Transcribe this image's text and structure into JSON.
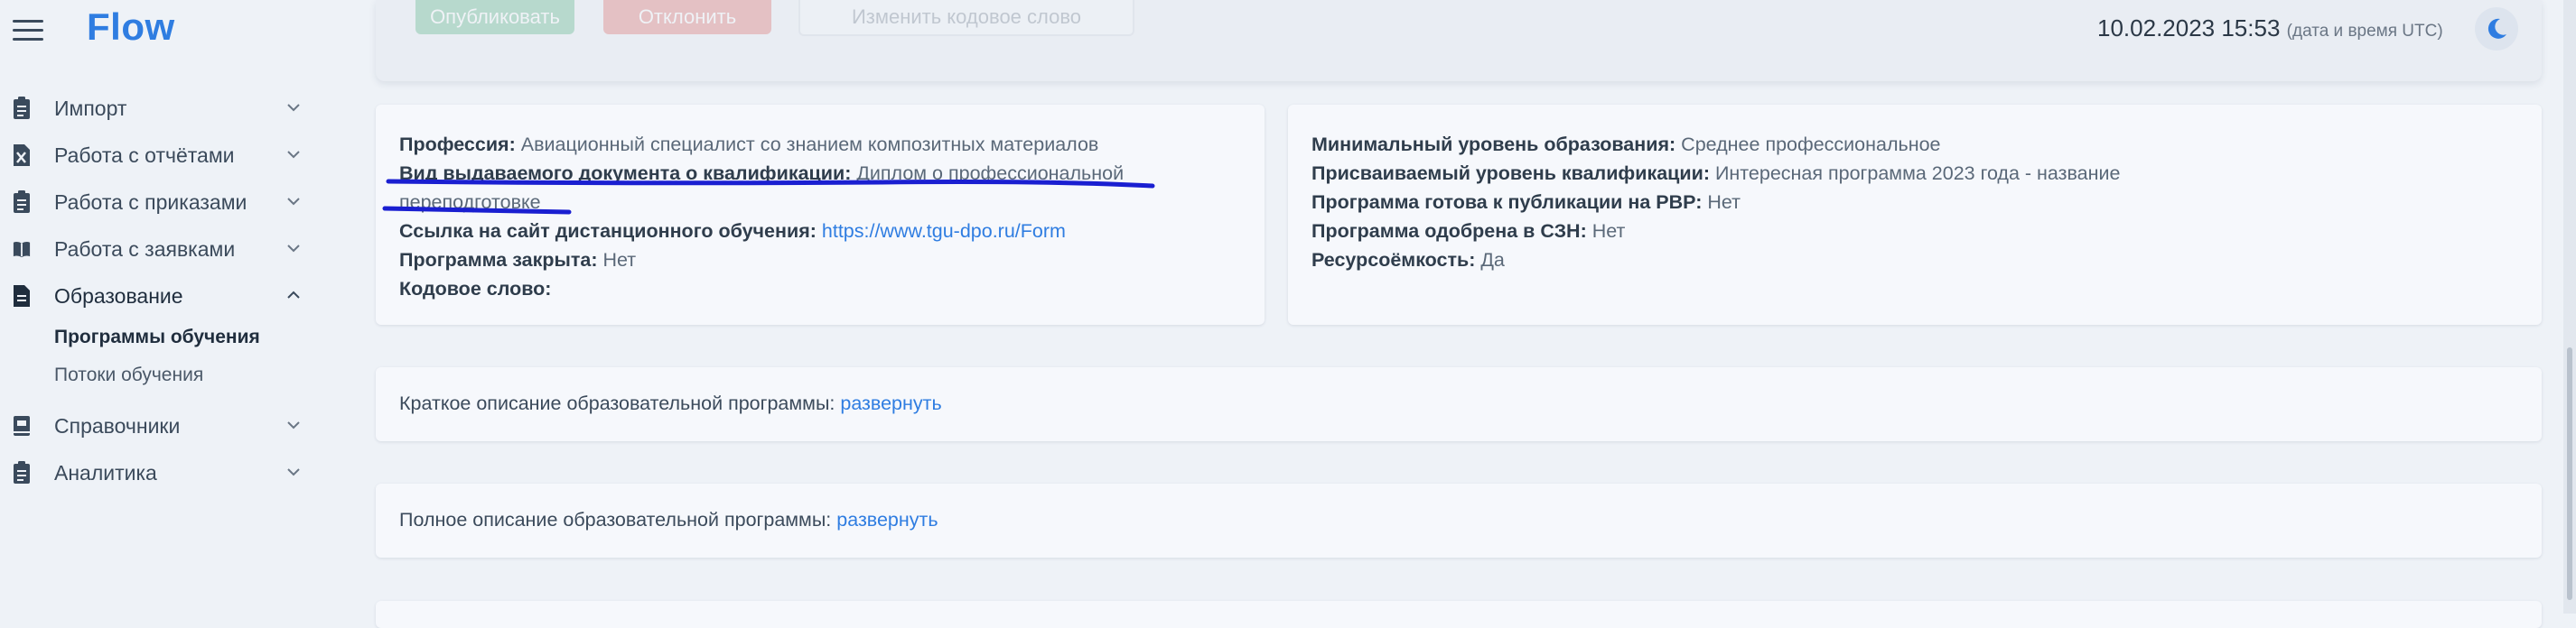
{
  "app": {
    "logo": "Flow"
  },
  "header": {
    "datetime": "10.02.2023 15:53",
    "datetime_note": "(дата и время UTC)",
    "buttons": [
      "Опубликовать",
      "Отклонить",
      "Изменить кодовое слово"
    ]
  },
  "sidebar": {
    "items": [
      {
        "label": "Импорт",
        "icon": "clipboard-icon"
      },
      {
        "label": "Работа с отчётами",
        "icon": "excel-file-icon"
      },
      {
        "label": "Работа с приказами",
        "icon": "clipboard-icon"
      },
      {
        "label": "Работа с заявками",
        "icon": "book-icon"
      },
      {
        "label": "Образование",
        "icon": "document-icon"
      },
      {
        "label": "Справочники",
        "icon": "book-icon"
      },
      {
        "label": "Аналитика",
        "icon": "clipboard-icon"
      }
    ],
    "subitems": [
      {
        "label": "Программы обучения"
      },
      {
        "label": "Потоки обучения"
      }
    ]
  },
  "details_left": {
    "profession_label": "Профессия:",
    "profession_value": "Авиационный специалист со знанием композитных материалов",
    "doc_type_label": "Вид выдаваемого документа о квалификации:",
    "doc_type_value_1": "Диплом о профессиональной",
    "doc_type_value_2": "переподготовке",
    "distance_link_label": "Ссылка на сайт дистанционного обучения:",
    "distance_link_value": "https://www.tgu-dpo.ru/Form",
    "closed_label": "Программа закрыта:",
    "closed_value": "Нет",
    "codeword_label": "Кодовое слово:"
  },
  "details_right": {
    "min_edu_label": "Минимальный уровень образования:",
    "min_edu_value": "Среднее профессиональное",
    "qual_label": "Присваиваемый уровень квалификации:",
    "qual_value": "Интересная программа 2023 года - название",
    "ready_label": "Программа готова к публикации на РВР:",
    "ready_value": "Нет",
    "approved_label": "Программа одобрена в СЗН:",
    "approved_value": "Нет",
    "resource_label": "Ресурсоёмкость:",
    "resource_value": "Да"
  },
  "short_description": {
    "label": "Краткое описание образовательной программы:",
    "link": "развернуть"
  },
  "full_description": {
    "label": "Полное описание образовательной программы:",
    "link": "развернуть"
  },
  "colors": {
    "accent": "#2f7de1",
    "annotation": "#1a1fd1",
    "background": "#eef2f7"
  }
}
